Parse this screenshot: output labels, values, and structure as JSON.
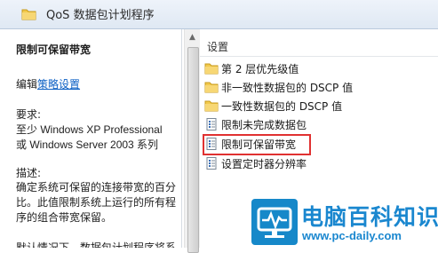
{
  "window": {
    "title": "QoS 数据包计划程序"
  },
  "left_pane": {
    "heading": "限制可保留带宽",
    "edit_prefix": "编辑",
    "edit_link": "策略设置",
    "requirements_label": "要求:",
    "requirements_line1": "至少 Windows XP Professional",
    "requirements_line2": "或 Windows Server 2003 系列",
    "description_label": "描述:",
    "description_text": "确定系统可保留的连接带宽的百分比。此值限制系统上运行的所有程序的组合带宽保留。",
    "description_more": "默认情况下，数据包计划程序将系"
  },
  "right_pane": {
    "column_header": "设置",
    "items": [
      {
        "label": "第 2 层优先级值",
        "icon": "folder-icon"
      },
      {
        "label": "非一致性数据包的 DSCP 值",
        "icon": "folder-icon"
      },
      {
        "label": "一致性数据包的 DSCP 值",
        "icon": "folder-icon"
      },
      {
        "label": "限制未完成数据包",
        "icon": "policy-setting-icon"
      },
      {
        "label": "限制可保留带宽",
        "icon": "policy-setting-icon"
      },
      {
        "label": "设置定时器分辨率",
        "icon": "policy-setting-icon"
      }
    ],
    "highlighted_item": "限制可保留带宽",
    "highlight_color": "#e03131"
  },
  "watermark": {
    "title": "电脑百科知识",
    "url": "www.pc-daily.com"
  }
}
